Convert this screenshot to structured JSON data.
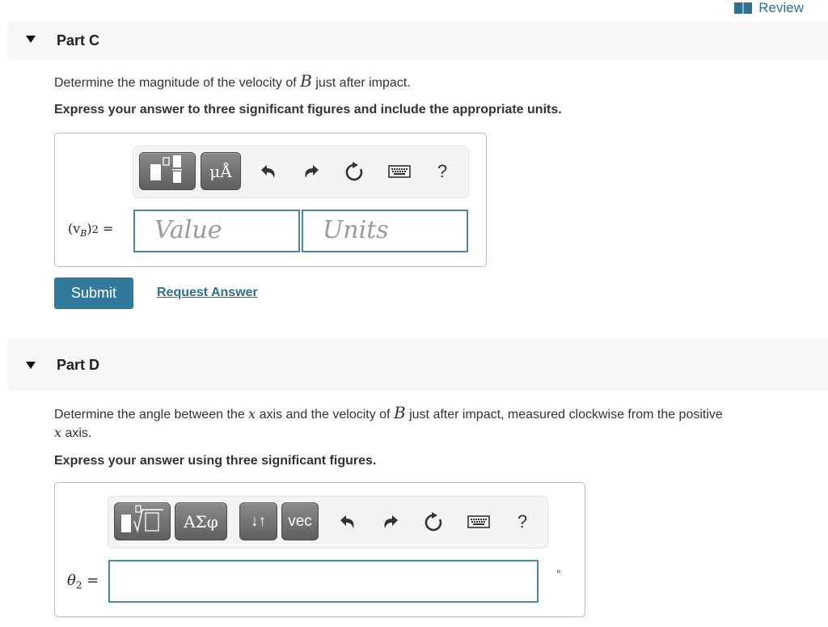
{
  "header": {
    "review_label": "Review",
    "review_icon": "book-icon",
    "accent_color": "#2f6f8f"
  },
  "parts": [
    {
      "title": "Part C",
      "question_pre": "Determine the magnitude of the velocity of ",
      "question_var": "B",
      "question_post": " just after impact.",
      "instruction": "Express your answer to three significant figures and include the appropriate units.",
      "toolbar": {
        "buttons": [
          {
            "icon": "template-icon",
            "label": ""
          },
          {
            "icon": "units-icon",
            "label": "μÅ"
          }
        ],
        "icons": [
          "undo-icon",
          "redo-icon",
          "reset-icon",
          "keyboard-icon",
          "help-icon"
        ],
        "help_label": "?"
      },
      "answer_label_var": "(v",
      "answer_label_sub": "B",
      "answer_label_post": ")",
      "answer_label_sub2": "2",
      "answer_label_eq": " =",
      "value_placeholder": "Value",
      "units_placeholder": "Units",
      "submit_label": "Submit",
      "request_answer_label": "Request Answer"
    },
    {
      "title": "Part D",
      "question_pre": "Determine the angle between the ",
      "question_var1": "x",
      "question_mid": " axis and the velocity of ",
      "question_var2": "B",
      "question_post": " just after impact, measured clockwise from the positive",
      "question_line2_var": "x",
      "question_line2_post": " axis.",
      "instruction": "Express your answer using three significant figures.",
      "toolbar": {
        "buttons": [
          {
            "icon": "templates-root-icon",
            "label": ""
          },
          {
            "icon": "greek-symbols-icon",
            "label": "ΑΣφ"
          },
          {
            "icon": "swap-arrows-icon",
            "label": "↓↑"
          },
          {
            "icon": "vector-icon",
            "label": "vec"
          }
        ],
        "icons": [
          "undo-icon",
          "redo-icon",
          "reset-icon",
          "keyboard-icon",
          "help-icon"
        ],
        "help_label": "?"
      },
      "answer_label_var": "θ",
      "answer_label_sub": "2",
      "answer_label_eq": " =",
      "answer_value": "",
      "unit_symbol": "°"
    }
  ]
}
